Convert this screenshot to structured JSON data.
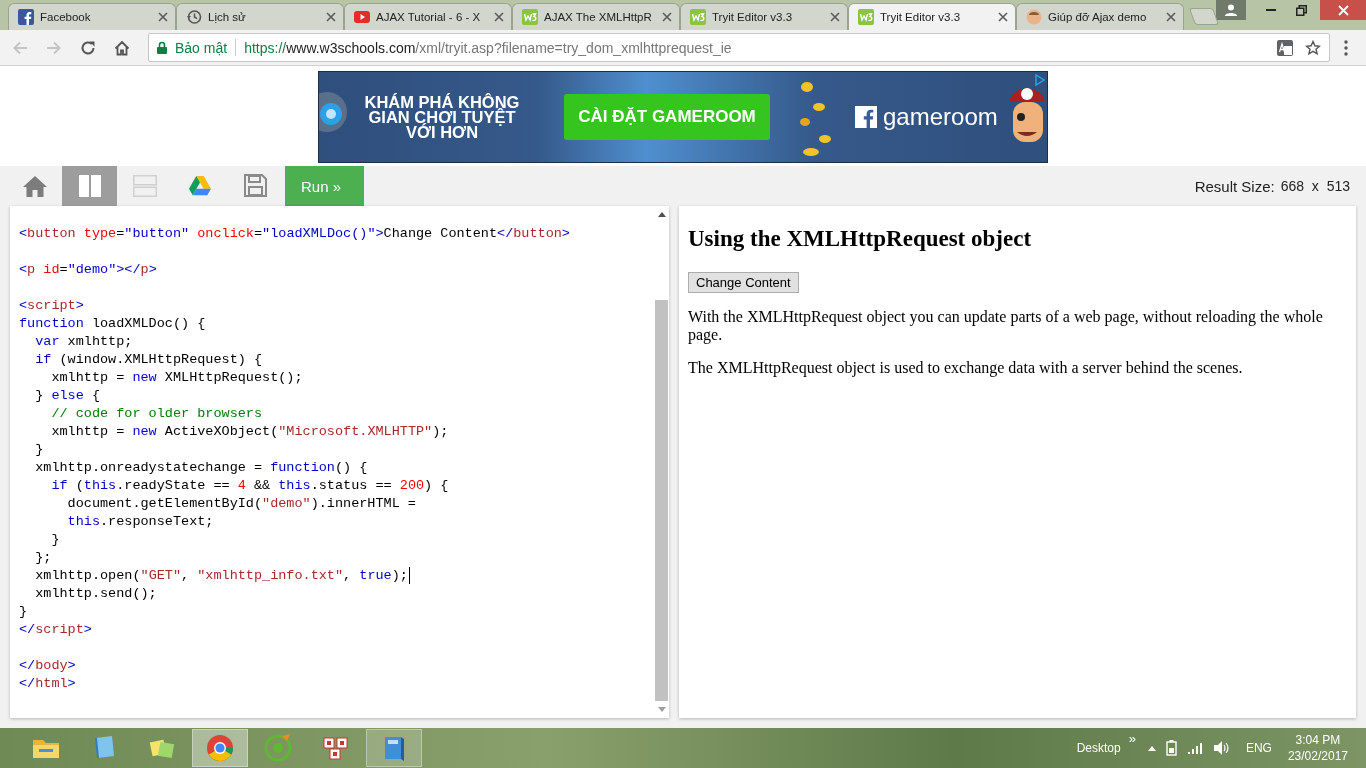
{
  "browser": {
    "tabs": [
      {
        "title": "Facebook",
        "kind": "facebook",
        "selected": false
      },
      {
        "title": "Lịch sử",
        "kind": "history",
        "selected": false
      },
      {
        "title": "AJAX Tutorial - 6 - X",
        "kind": "video",
        "selected": false
      },
      {
        "title": "AJAX The XMLHttpR",
        "kind": "w3",
        "selected": false
      },
      {
        "title": "Tryit Editor v3.3",
        "kind": "w3",
        "selected": false
      },
      {
        "title": "Tryit Editor v3.3",
        "kind": "w3",
        "selected": true
      },
      {
        "title": "Giúp đỡ Ajax demo",
        "kind": "avatar",
        "selected": false
      }
    ],
    "address_bar": {
      "security_label": "Bảo mật",
      "url": {
        "scheme": "https://",
        "host": "www.w3schools.com",
        "path": "/xml/tryit.asp?filename=try_dom_xmlhttprequest_ie"
      }
    }
  },
  "ad": {
    "headline": [
      "KHÁM PHÁ KHÔNG",
      "GIAN CHƠI TUYỆT",
      "VỚI HƠN"
    ],
    "button": "CÀI ĐẶT GAMEROOM",
    "brand": "gameroom"
  },
  "toolbar": {
    "buttons": [
      {
        "kind": "home",
        "selected": false
      },
      {
        "kind": "columns",
        "selected": true
      },
      {
        "kind": "rows",
        "selected": false
      },
      {
        "kind": "drive",
        "selected": false
      },
      {
        "kind": "save",
        "selected": false
      }
    ],
    "run_label": "Run »",
    "result_size_label": "Result Size:",
    "result_size": "668  x  513"
  },
  "editor": {
    "blocks": [
      [
        {
          "caret": false,
          "tokens": [
            {
              "kind": "b",
              "text": "<"
            },
            {
              "kind": "tag",
              "text": "button"
            },
            {
              "kind": "attr",
              "text": " type"
            },
            {
              "kind": "t",
              "text": "="
            },
            {
              "kind": "val",
              "text": "\"button\""
            },
            {
              "kind": "attr",
              "text": " onclick"
            },
            {
              "kind": "t",
              "text": "="
            },
            {
              "kind": "val",
              "text": "\"loadXMLDoc()\""
            },
            {
              "kind": "b",
              "text": ">"
            },
            {
              "kind": "t",
              "text": "Change Content"
            },
            {
              "kind": "b",
              "text": "</"
            },
            {
              "kind": "tag",
              "text": "button"
            },
            {
              "kind": "b",
              "text": ">"
            }
          ]
        }
      ],
      [
        {
          "caret": false,
          "tokens": [
            {
              "kind": "b",
              "text": "<"
            },
            {
              "kind": "tag",
              "text": "p"
            },
            {
              "kind": "attr",
              "text": " id"
            },
            {
              "kind": "t",
              "text": "="
            },
            {
              "kind": "val",
              "text": "\"demo\""
            },
            {
              "kind": "b",
              "text": "></"
            },
            {
              "kind": "tag",
              "text": "p"
            },
            {
              "kind": "b",
              "text": ">"
            }
          ]
        }
      ],
      [
        {
          "caret": false,
          "tokens": [
            {
              "kind": "b",
              "text": "<"
            },
            {
              "kind": "tag",
              "text": "script"
            },
            {
              "kind": "b",
              "text": ">"
            }
          ]
        },
        {
          "caret": false,
          "tokens": [
            {
              "kind": "kw",
              "text": "function"
            },
            {
              "kind": "t",
              "text": " loadXMLDoc() {"
            }
          ]
        },
        {
          "caret": false,
          "tokens": [
            {
              "kind": "kw",
              "text": "  var"
            },
            {
              "kind": "t",
              "text": " xmlhttp;"
            }
          ]
        },
        {
          "caret": false,
          "tokens": [
            {
              "kind": "kw",
              "text": "  if"
            },
            {
              "kind": "t",
              "text": " (window.XMLHttpRequest) {"
            }
          ]
        },
        {
          "caret": false,
          "tokens": [
            {
              "kind": "t",
              "text": "    xmlhttp = "
            },
            {
              "kind": "kw",
              "text": "new"
            },
            {
              "kind": "t",
              "text": " XMLHttpRequest();"
            }
          ]
        },
        {
          "caret": false,
          "tokens": [
            {
              "kind": "t",
              "text": "  } "
            },
            {
              "kind": "kw",
              "text": "else"
            },
            {
              "kind": "t",
              "text": " {"
            }
          ]
        },
        {
          "caret": false,
          "tokens": [
            {
              "kind": "cm",
              "text": "    // code for older browsers"
            }
          ]
        },
        {
          "caret": false,
          "tokens": [
            {
              "kind": "t",
              "text": "    xmlhttp = "
            },
            {
              "kind": "kw",
              "text": "new"
            },
            {
              "kind": "t",
              "text": " ActiveXObject("
            },
            {
              "kind": "str",
              "text": "\"Microsoft.XMLHTTP\""
            },
            {
              "kind": "t",
              "text": ");"
            }
          ]
        },
        {
          "caret": false,
          "tokens": [
            {
              "kind": "t",
              "text": "  }"
            }
          ]
        },
        {
          "caret": false,
          "tokens": [
            {
              "kind": "t",
              "text": "  xmlhttp.onreadystatechange = "
            },
            {
              "kind": "kw",
              "text": "function"
            },
            {
              "kind": "t",
              "text": "() {"
            }
          ]
        },
        {
          "caret": false,
          "tokens": [
            {
              "kind": "kw",
              "text": "    if"
            },
            {
              "kind": "t",
              "text": " ("
            },
            {
              "kind": "kw",
              "text": "this"
            },
            {
              "kind": "t",
              "text": ".readyState == "
            },
            {
              "kind": "num",
              "text": "4"
            },
            {
              "kind": "t",
              "text": " && "
            },
            {
              "kind": "kw",
              "text": "this"
            },
            {
              "kind": "t",
              "text": ".status == "
            },
            {
              "kind": "num",
              "text": "200"
            },
            {
              "kind": "t",
              "text": ") {"
            }
          ]
        },
        {
          "caret": false,
          "tokens": [
            {
              "kind": "t",
              "text": "      document.getElementById("
            },
            {
              "kind": "str",
              "text": "\"demo\""
            },
            {
              "kind": "t",
              "text": ").innerHTML ="
            }
          ]
        },
        {
          "caret": false,
          "tokens": [
            {
              "kind": "kw",
              "text": "      this"
            },
            {
              "kind": "t",
              "text": ".responseText;"
            }
          ]
        },
        {
          "caret": false,
          "tokens": [
            {
              "kind": "t",
              "text": "    }"
            }
          ]
        },
        {
          "caret": false,
          "tokens": [
            {
              "kind": "t",
              "text": "  };"
            }
          ]
        },
        {
          "caret": true,
          "tokens": [
            {
              "kind": "t",
              "text": "  xmlhttp.open("
            },
            {
              "kind": "str",
              "text": "\"GET\""
            },
            {
              "kind": "t",
              "text": ", "
            },
            {
              "kind": "str",
              "text": "\"xmlhttp_info.txt\""
            },
            {
              "kind": "t",
              "text": ", "
            },
            {
              "kind": "kw",
              "text": "true"
            },
            {
              "kind": "t",
              "text": ");"
            }
          ]
        },
        {
          "caret": false,
          "tokens": [
            {
              "kind": "t",
              "text": "  xmlhttp.send();"
            }
          ]
        },
        {
          "caret": false,
          "tokens": [
            {
              "kind": "t",
              "text": "}"
            }
          ]
        },
        {
          "caret": false,
          "tokens": [
            {
              "kind": "b",
              "text": "</"
            },
            {
              "kind": "tag",
              "text": "script"
            },
            {
              "kind": "b",
              "text": ">"
            }
          ]
        }
      ],
      [
        {
          "caret": false,
          "tokens": [
            {
              "kind": "b",
              "text": "</"
            },
            {
              "kind": "tag",
              "text": "body"
            },
            {
              "kind": "b",
              "text": ">"
            }
          ]
        },
        {
          "caret": false,
          "tokens": [
            {
              "kind": "b",
              "text": "</"
            },
            {
              "kind": "tag",
              "text": "html"
            },
            {
              "kind": "b",
              "text": ">"
            }
          ]
        }
      ]
    ]
  },
  "result": {
    "heading": "Using the XMLHttpRequest object",
    "button": "Change Content",
    "paragraphs": [
      "With the XMLHttpRequest object you can update parts of a web page, without reloading the whole page.",
      "The XMLHttpRequest object is used to exchange data with a server behind the scenes."
    ]
  },
  "taskbar": {
    "apps": [
      {
        "kind": "folder",
        "selected": false,
        "running": false
      },
      {
        "kind": "notebook",
        "selected": false,
        "running": false
      },
      {
        "kind": "notes",
        "selected": false,
        "running": false
      },
      {
        "kind": "chrome",
        "selected": true,
        "running": true
      },
      {
        "kind": "coccoc",
        "selected": false,
        "running": false
      },
      {
        "kind": "unikey",
        "selected": false,
        "running": false
      },
      {
        "kind": "book",
        "selected": false,
        "running": true
      }
    ],
    "toolbar_label": "Desktop",
    "chevron": "»",
    "language": "ENG",
    "time": "3:04 PM",
    "date": "23/02/2017"
  }
}
